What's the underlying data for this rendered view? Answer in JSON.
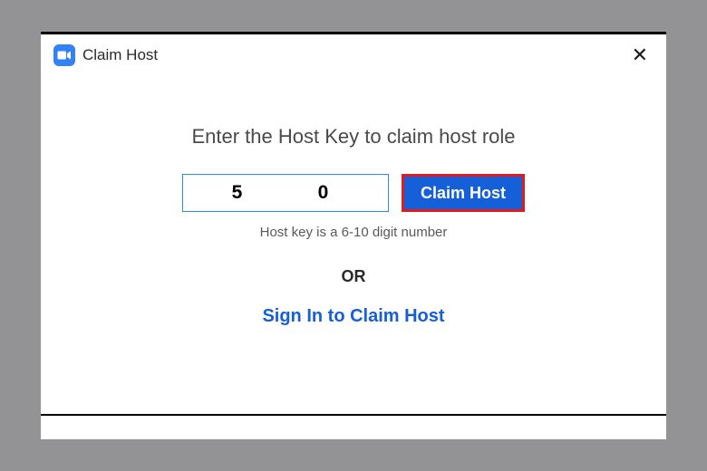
{
  "titlebar": {
    "title": "Claim Host",
    "close_glyph": "✕"
  },
  "content": {
    "headline": "Enter the Host Key to claim host role",
    "host_key_value": "5    0",
    "host_key_placeholder": "",
    "claim_button_label": "Claim Host",
    "hint": "Host key is a 6-10 digit number",
    "or_label": "OR",
    "signin_link_label": "Sign In to Claim Host"
  },
  "colors": {
    "brand_blue": "#155fd8",
    "input_border": "#2a8bf2",
    "highlight_red": "#e11b1b"
  }
}
